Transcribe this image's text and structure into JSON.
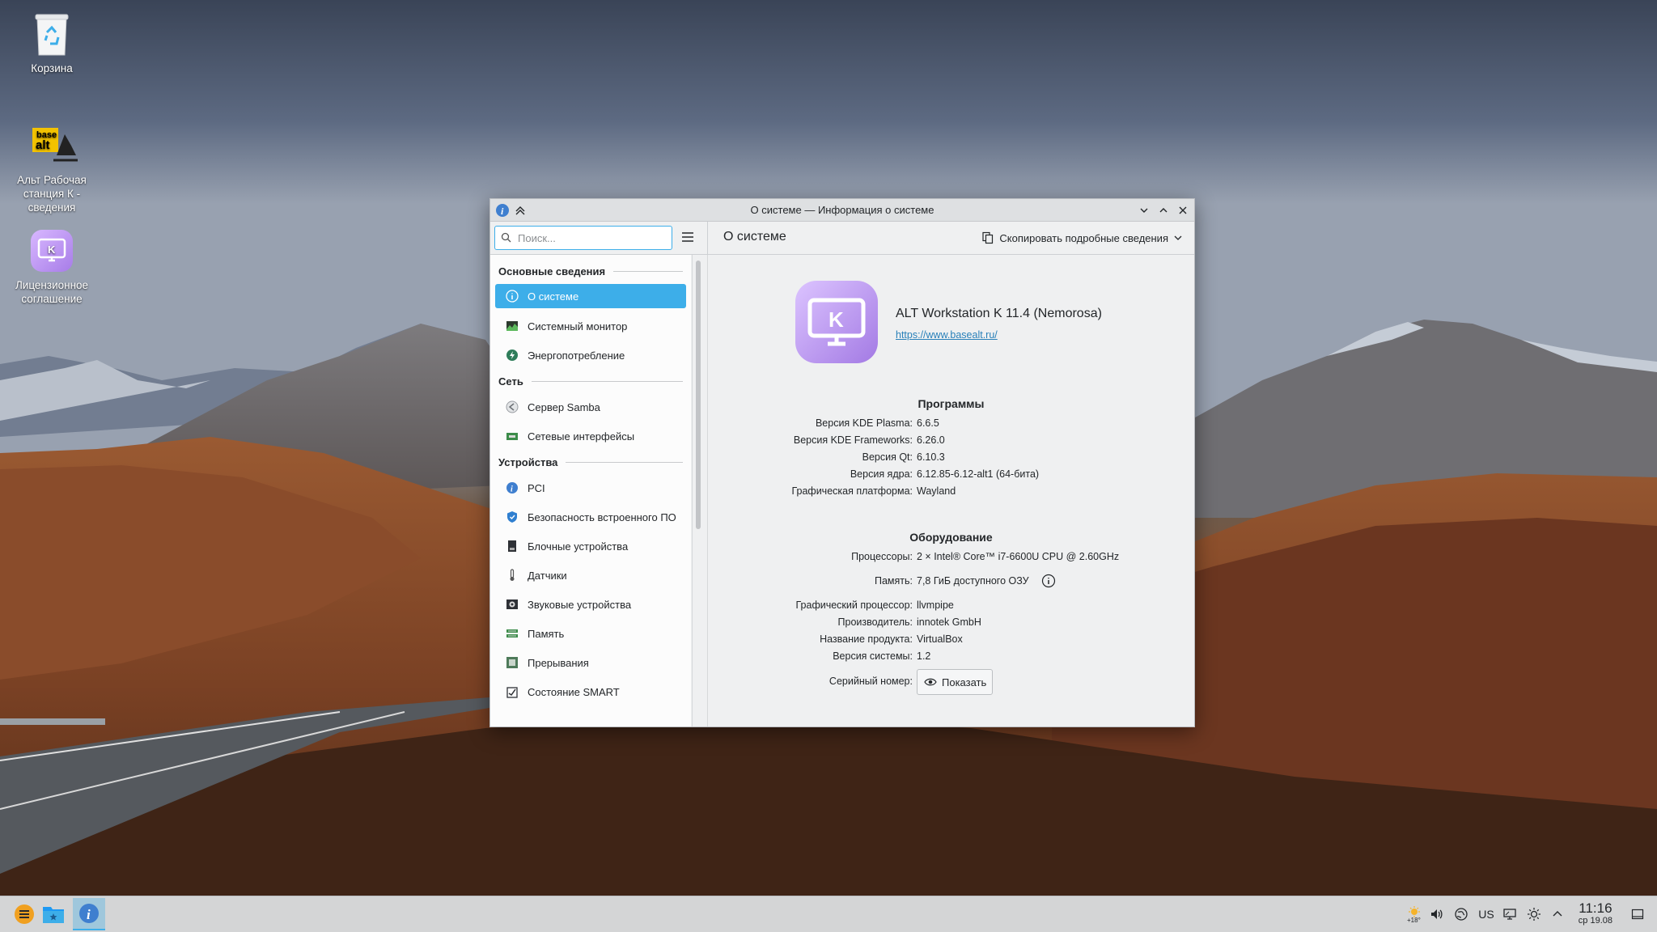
{
  "desktop": {
    "icons": [
      {
        "label": "Корзина"
      },
      {
        "label": "Альт Рабочая станция К - сведения"
      },
      {
        "label": "Лицензионное соглашение"
      }
    ],
    "alt_logo_text": "base alt"
  },
  "window": {
    "title": "О системе — Информация о системе",
    "search_placeholder": "Поиск...",
    "page_title": "О системе",
    "copy_label": "Скопировать подробные сведения",
    "sidebar": {
      "categories": [
        {
          "label": "Основные сведения",
          "items": [
            {
              "label": "О системе",
              "icon": "info-icon",
              "selected": true
            },
            {
              "label": "Системный монитор",
              "icon": "system-monitor-icon"
            },
            {
              "label": "Энергопотребление",
              "icon": "power-icon"
            }
          ]
        },
        {
          "label": "Сеть",
          "items": [
            {
              "label": "Сервер Samba",
              "icon": "samba-icon"
            },
            {
              "label": "Сетевые интерфейсы",
              "icon": "network-icon"
            }
          ]
        },
        {
          "label": "Устройства",
          "items": [
            {
              "label": "PCI",
              "icon": "pci-icon"
            },
            {
              "label": "Безопасность встроенного ПО",
              "icon": "shield-icon"
            },
            {
              "label": "Блочные устройства",
              "icon": "block-device-icon"
            },
            {
              "label": "Датчики",
              "icon": "sensor-icon"
            },
            {
              "label": "Звуковые устройства",
              "icon": "audio-icon"
            },
            {
              "label": "Память",
              "icon": "memory-icon"
            },
            {
              "label": "Прерывания",
              "icon": "interrupts-icon"
            },
            {
              "label": "Состояние SMART",
              "icon": "smart-icon"
            }
          ]
        }
      ]
    },
    "os_name": "ALT Workstation K 11.4 (Nemorosa)",
    "os_url": "https://www.basealt.ru/",
    "software_title": "Программы",
    "software": [
      {
        "key": "Версия KDE Plasma:",
        "value": "6.6.5"
      },
      {
        "key": "Версия KDE Frameworks:",
        "value": "6.26.0"
      },
      {
        "key": "Версия Qt:",
        "value": "6.10.3"
      },
      {
        "key": "Версия ядра:",
        "value": "6.12.85-6.12-alt1 (64-бита)"
      },
      {
        "key": "Графическая платформа:",
        "value": "Wayland"
      }
    ],
    "hardware_title": "Оборудование",
    "hardware": [
      {
        "key": "Процессоры:",
        "value": "2 × Intel® Core™ i7-6600U CPU @ 2.60GHz"
      },
      {
        "key": "Память:",
        "value": "7,8 ГиБ доступного ОЗУ"
      },
      {
        "key": "Графический процессор:",
        "value": "llvmpipe"
      },
      {
        "key": "Производитель:",
        "value": "innotek GmbH"
      },
      {
        "key": "Название продукта:",
        "value": "VirtualBox"
      },
      {
        "key": "Версия системы:",
        "value": "1.2"
      },
      {
        "key": "Серийный номер:",
        "value": ""
      }
    ],
    "show_label": "Показать"
  },
  "taskbar": {
    "keyboard_layout": "US",
    "time": "11:16",
    "date": "ср 19.08",
    "weather_temp": "+18°"
  },
  "colors": {
    "accent": "#3daee9",
    "link": "#2980b9"
  }
}
